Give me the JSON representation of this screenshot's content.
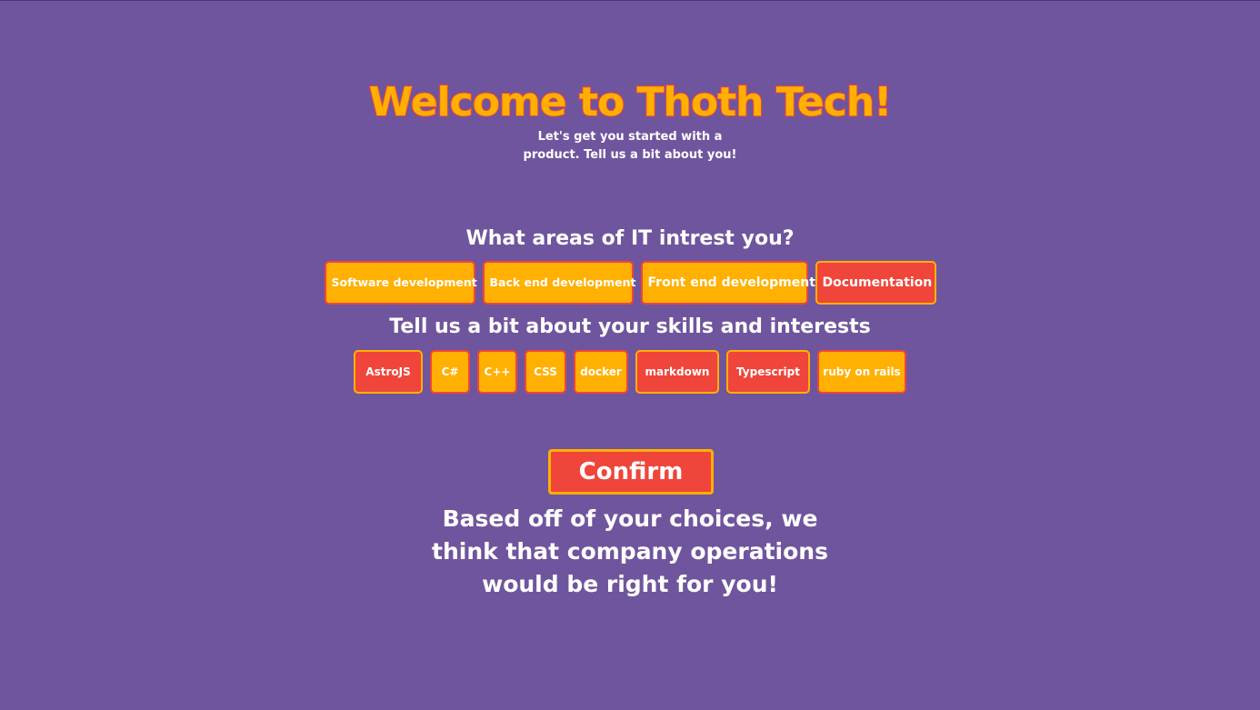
{
  "header": {
    "title": "Welcome to Thoth Tech!",
    "subtitle": "Let's get you started with a product. Tell us a bit about you!"
  },
  "areas": {
    "heading": "What areas of IT intrest you?",
    "options": [
      {
        "label": "Software development",
        "style": "yellow"
      },
      {
        "label": "Back end development",
        "style": "yellow"
      },
      {
        "label": "Front end development",
        "style": "yellow"
      },
      {
        "label": "Documentation",
        "style": "red"
      }
    ]
  },
  "skills": {
    "heading": "Tell us a bit about your skills and interests",
    "options": [
      {
        "label": "AstroJS",
        "style": "red"
      },
      {
        "label": "C#",
        "style": "yellow"
      },
      {
        "label": "C++",
        "style": "yellow"
      },
      {
        "label": "CSS",
        "style": "yellow"
      },
      {
        "label": "docker",
        "style": "yellow"
      },
      {
        "label": "markdown",
        "style": "red"
      },
      {
        "label": "Typescript",
        "style": "red"
      },
      {
        "label": "ruby on rails",
        "style": "yellow"
      }
    ]
  },
  "confirm_label": "Confirm",
  "result_text": "Based off of your choices, we think that company operations would be right for you!",
  "colors": {
    "background": "#6f559d",
    "accent_yellow": "#ffb000",
    "accent_red": "#f0453a",
    "text": "#ffffff"
  }
}
